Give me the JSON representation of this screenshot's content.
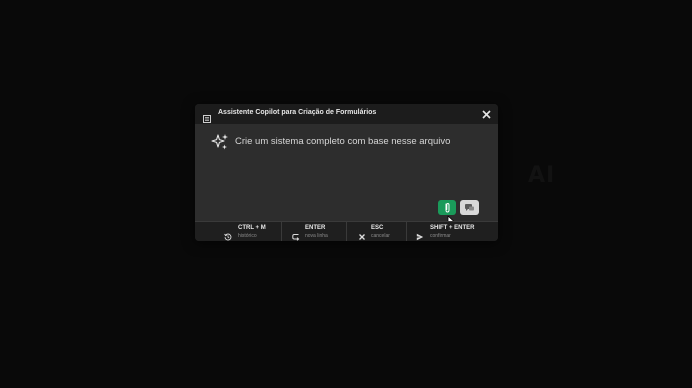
{
  "background": {
    "watermark": "AI"
  },
  "dialog": {
    "title": "Assistente Copilot para Criação de Formulários",
    "prompt": "Crie um sistema completo com base nesse arquivo",
    "icons": {
      "title": "document-list-icon",
      "close": "close-icon",
      "prompt": "sparkle-icon",
      "attach": "paperclip-icon",
      "chat": "chat-icon"
    },
    "colors": {
      "attach_button": "#1a9a5a",
      "chat_button": "#d9d9d9"
    }
  },
  "shortcuts": [
    {
      "key": "CTRL + M",
      "hint": "histórico",
      "icon": "history-icon"
    },
    {
      "key": "ENTER",
      "hint": "nova linha",
      "icon": "newline-icon"
    },
    {
      "key": "ESC",
      "hint": "cancelar",
      "icon": "close-icon"
    },
    {
      "key": "SHIFT + ENTER",
      "hint": "confirmar",
      "icon": "send-icon"
    }
  ]
}
